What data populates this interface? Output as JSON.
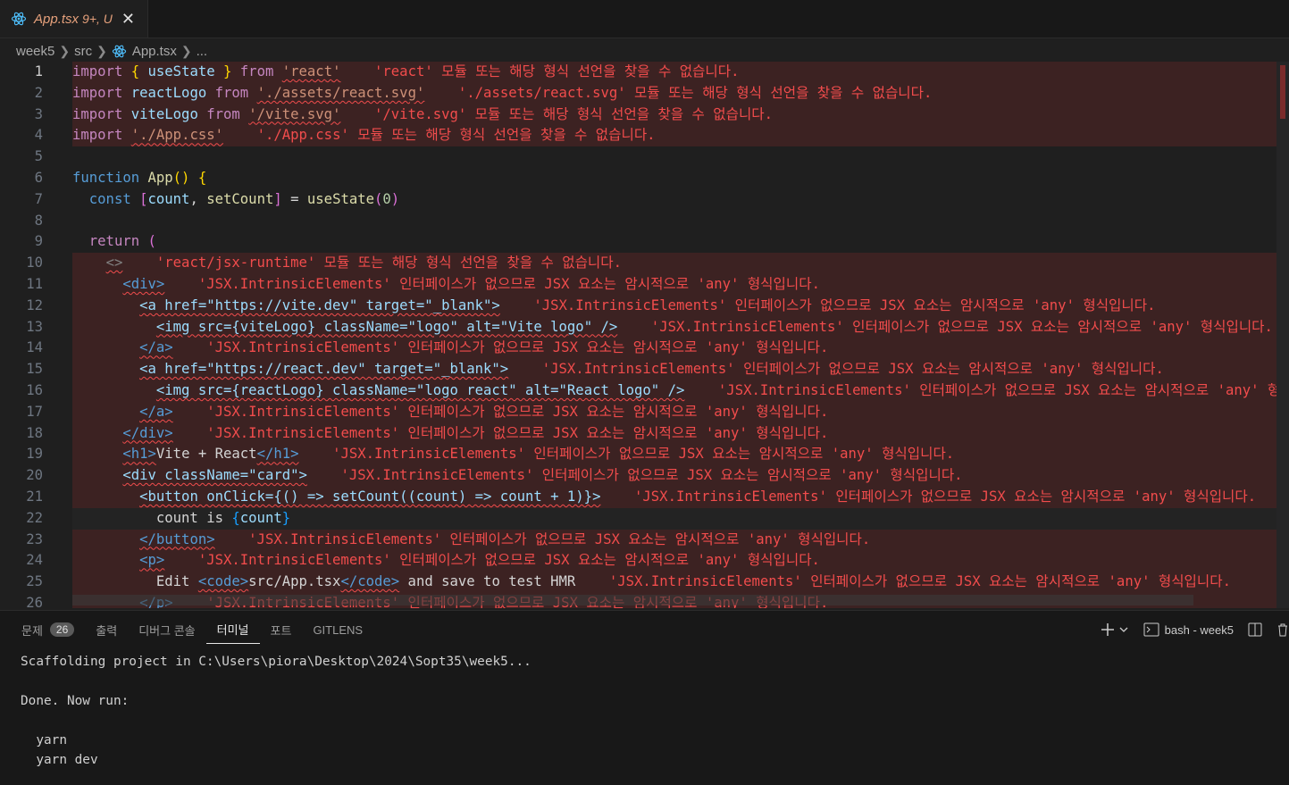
{
  "tab": {
    "filename": "App.tsx",
    "meta": "9+, U",
    "close": "✕",
    "icon": "react-icon"
  },
  "breadcrumb": {
    "items": [
      "week5",
      "src",
      "App.tsx",
      "..."
    ]
  },
  "editor": {
    "lines": [
      {
        "n": "1",
        "segs": [
          {
            "t": "import",
            "c": "imp"
          },
          {
            "t": " "
          },
          {
            "t": "{",
            "c": "br1"
          },
          {
            "t": " useState ",
            "c": "vr"
          },
          {
            "t": "}",
            "c": "br1"
          },
          {
            "t": " from ",
            "c": "imp"
          },
          {
            "t": "'react'",
            "c": "str sq"
          },
          {
            "t": "    'react' 모듈 또는 해당 형식 선언을 찾을 수 없습니다.",
            "c": "msg"
          }
        ],
        "err": true,
        "cur": true
      },
      {
        "n": "2",
        "segs": [
          {
            "t": "import",
            "c": "imp"
          },
          {
            "t": " reactLogo ",
            "c": "vr"
          },
          {
            "t": "from ",
            "c": "imp"
          },
          {
            "t": "'./assets/react.svg'",
            "c": "str sq"
          },
          {
            "t": "    './assets/react.svg' 모듈 또는 해당 형식 선언을 찾을 수 없습니다.",
            "c": "msg"
          }
        ],
        "err": true
      },
      {
        "n": "3",
        "segs": [
          {
            "t": "import",
            "c": "imp"
          },
          {
            "t": " viteLogo ",
            "c": "vr"
          },
          {
            "t": "from ",
            "c": "imp"
          },
          {
            "t": "'/vite.svg'",
            "c": "str sq"
          },
          {
            "t": "    '/vite.svg' 모듈 또는 해당 형식 선언을 찾을 수 없습니다.",
            "c": "msg"
          }
        ],
        "err": true
      },
      {
        "n": "4",
        "segs": [
          {
            "t": "import",
            "c": "imp"
          },
          {
            "t": " "
          },
          {
            "t": "'./App.css'",
            "c": "str sq"
          },
          {
            "t": "    './App.css' 모듈 또는 해당 형식 선언을 찾을 수 없습니다.",
            "c": "msg"
          }
        ],
        "err": true
      },
      {
        "n": "5",
        "segs": []
      },
      {
        "n": "6",
        "segs": [
          {
            "t": "function",
            "c": "kw"
          },
          {
            "t": " App",
            "c": "fn"
          },
          {
            "t": "()",
            "c": "br1"
          },
          {
            "t": " "
          },
          {
            "t": "{",
            "c": "br1"
          }
        ]
      },
      {
        "n": "7",
        "segs": [
          {
            "t": "  const",
            "c": "kw"
          },
          {
            "t": " "
          },
          {
            "t": "[",
            "c": "br2"
          },
          {
            "t": "count",
            "c": "vr"
          },
          {
            "t": ", ",
            "c": "txt"
          },
          {
            "t": "setCount",
            "c": "fn"
          },
          {
            "t": "]",
            "c": "br2"
          },
          {
            "t": " = ",
            "c": "txt"
          },
          {
            "t": "useState",
            "c": "fn"
          },
          {
            "t": "(",
            "c": "br2"
          },
          {
            "t": "0",
            "c": "num"
          },
          {
            "t": ")",
            "c": "br2"
          }
        ]
      },
      {
        "n": "8",
        "segs": []
      },
      {
        "n": "9",
        "segs": [
          {
            "t": "  return",
            "c": "imp"
          },
          {
            "t": " "
          },
          {
            "t": "(",
            "c": "br2"
          }
        ]
      },
      {
        "n": "10",
        "segs": [
          {
            "t": "    "
          },
          {
            "t": "<>",
            "c": "gt sq"
          },
          {
            "t": "    'react/jsx-runtime' 모듈 또는 해당 형식 선언을 찾을 수 없습니다.",
            "c": "msg"
          }
        ],
        "err": true
      },
      {
        "n": "11",
        "segs": [
          {
            "t": "      "
          },
          {
            "t": "<div>",
            "c": "tag sq"
          },
          {
            "t": "    'JSX.IntrinsicElements' 인터페이스가 없으므로 JSX 요소는 암시적으로 'any' 형식입니다.",
            "c": "msg"
          }
        ],
        "err": true
      },
      {
        "n": "12",
        "segs": [
          {
            "t": "        "
          },
          {
            "t": "<a href=\"https://vite.dev\" target=\"_blank\">",
            "c": "vr sq"
          },
          {
            "t": "    'JSX.IntrinsicElements' 인터페이스가 없으므로 JSX 요소는 암시적으로 'any' 형식입니다.",
            "c": "msg"
          }
        ],
        "err": true
      },
      {
        "n": "13",
        "segs": [
          {
            "t": "          "
          },
          {
            "t": "<img src={viteLogo} className=\"logo\" alt=\"Vite logo\" />",
            "c": "vr sq"
          },
          {
            "t": "    'JSX.IntrinsicElements' 인터페이스가 없으므로 JSX 요소는 암시적으로 'any' 형식입니다.",
            "c": "msg"
          }
        ],
        "err": true
      },
      {
        "n": "14",
        "segs": [
          {
            "t": "        "
          },
          {
            "t": "</a>",
            "c": "tag sq"
          },
          {
            "t": "    'JSX.IntrinsicElements' 인터페이스가 없으므로 JSX 요소는 암시적으로 'any' 형식입니다.",
            "c": "msg"
          }
        ],
        "err": true
      },
      {
        "n": "15",
        "segs": [
          {
            "t": "        "
          },
          {
            "t": "<a href=\"https://react.dev\" target=\"_blank\">",
            "c": "vr sq"
          },
          {
            "t": "    'JSX.IntrinsicElements' 인터페이스가 없으므로 JSX 요소는 암시적으로 'any' 형식입니다.",
            "c": "msg"
          }
        ],
        "err": true
      },
      {
        "n": "16",
        "segs": [
          {
            "t": "          "
          },
          {
            "t": "<img src={reactLogo} className=\"logo react\" alt=\"React logo\" />",
            "c": "vr sq"
          },
          {
            "t": "    'JSX.IntrinsicElements' 인터페이스가 없으므로 JSX 요소는 암시적으로 'any' 형식",
            "c": "msg"
          }
        ],
        "err": true
      },
      {
        "n": "17",
        "segs": [
          {
            "t": "        "
          },
          {
            "t": "</a>",
            "c": "tag sq"
          },
          {
            "t": "    'JSX.IntrinsicElements' 인터페이스가 없으므로 JSX 요소는 암시적으로 'any' 형식입니다.",
            "c": "msg"
          }
        ],
        "err": true
      },
      {
        "n": "18",
        "segs": [
          {
            "t": "      "
          },
          {
            "t": "</div>",
            "c": "tag sq"
          },
          {
            "t": "    'JSX.IntrinsicElements' 인터페이스가 없으므로 JSX 요소는 암시적으로 'any' 형식입니다.",
            "c": "msg"
          }
        ],
        "err": true
      },
      {
        "n": "19",
        "segs": [
          {
            "t": "      "
          },
          {
            "t": "<h1>",
            "c": "tag sq"
          },
          {
            "t": "Vite + React",
            "c": "txt"
          },
          {
            "t": "</h1>",
            "c": "tag sq"
          },
          {
            "t": "    'JSX.IntrinsicElements' 인터페이스가 없으므로 JSX 요소는 암시적으로 'any' 형식입니다.",
            "c": "msg"
          }
        ],
        "err": true
      },
      {
        "n": "20",
        "segs": [
          {
            "t": "      "
          },
          {
            "t": "<div className=\"card\">",
            "c": "vr sq"
          },
          {
            "t": "    'JSX.IntrinsicElements' 인터페이스가 없으므로 JSX 요소는 암시적으로 'any' 형식입니다.",
            "c": "msg"
          }
        ],
        "err": true
      },
      {
        "n": "21",
        "segs": [
          {
            "t": "        "
          },
          {
            "t": "<button onClick={() => setCount((count) => count + 1)}>",
            "c": "vr sq"
          },
          {
            "t": "    'JSX.IntrinsicElements' 인터페이스가 없으므로 JSX 요소는 암시적으로 'any' 형식입니다.",
            "c": "msg"
          }
        ],
        "err": true
      },
      {
        "n": "22",
        "segs": [
          {
            "t": "          count is ",
            "c": "txt"
          },
          {
            "t": "{",
            "c": "br3"
          },
          {
            "t": "count",
            "c": "vr"
          },
          {
            "t": "}",
            "c": "br3"
          }
        ],
        "curl": true
      },
      {
        "n": "23",
        "segs": [
          {
            "t": "        "
          },
          {
            "t": "</button>",
            "c": "tag sq"
          },
          {
            "t": "    'JSX.IntrinsicElements' 인터페이스가 없으므로 JSX 요소는 암시적으로 'any' 형식입니다.",
            "c": "msg"
          }
        ],
        "err": true
      },
      {
        "n": "24",
        "segs": [
          {
            "t": "        "
          },
          {
            "t": "<p>",
            "c": "tag sq"
          },
          {
            "t": "    'JSX.IntrinsicElements' 인터페이스가 없으므로 JSX 요소는 암시적으로 'any' 형식입니다.",
            "c": "msg"
          }
        ],
        "err": true
      },
      {
        "n": "25",
        "segs": [
          {
            "t": "          Edit ",
            "c": "txt"
          },
          {
            "t": "<code>",
            "c": "tag sq"
          },
          {
            "t": "src/App.tsx",
            "c": "txt"
          },
          {
            "t": "</code>",
            "c": "tag sq"
          },
          {
            "t": " and save to test HMR",
            "c": "txt"
          },
          {
            "t": "    'JSX.IntrinsicElements' 인터페이스가 없으므로 JSX 요소는 암시적으로 'any' 형식입니다.",
            "c": "msg"
          }
        ],
        "err": true
      },
      {
        "n": "26",
        "segs": [
          {
            "t": "        "
          },
          {
            "t": "</p>",
            "c": "tag sq"
          },
          {
            "t": "    'JSX.IntrinsicElements' 인터페이스가 없으므로 JSX 요소는 암시적으로 'any' 형식입니다.",
            "c": "msg"
          }
        ],
        "err": true
      }
    ]
  },
  "panel": {
    "tabs": [
      {
        "label": "문제",
        "badge": "26"
      },
      {
        "label": "출력"
      },
      {
        "label": "디버그 콘솔"
      },
      {
        "label": "터미널",
        "active": true
      },
      {
        "label": "포트"
      },
      {
        "label": "GITLENS"
      }
    ],
    "terminal_name": "bash - week5",
    "terminal_lines": [
      "Scaffolding project in C:\\Users\\piora\\Desktop\\2024\\Sopt35\\week5...",
      "",
      "Done. Now run:",
      "",
      "  yarn",
      "  yarn dev"
    ]
  }
}
